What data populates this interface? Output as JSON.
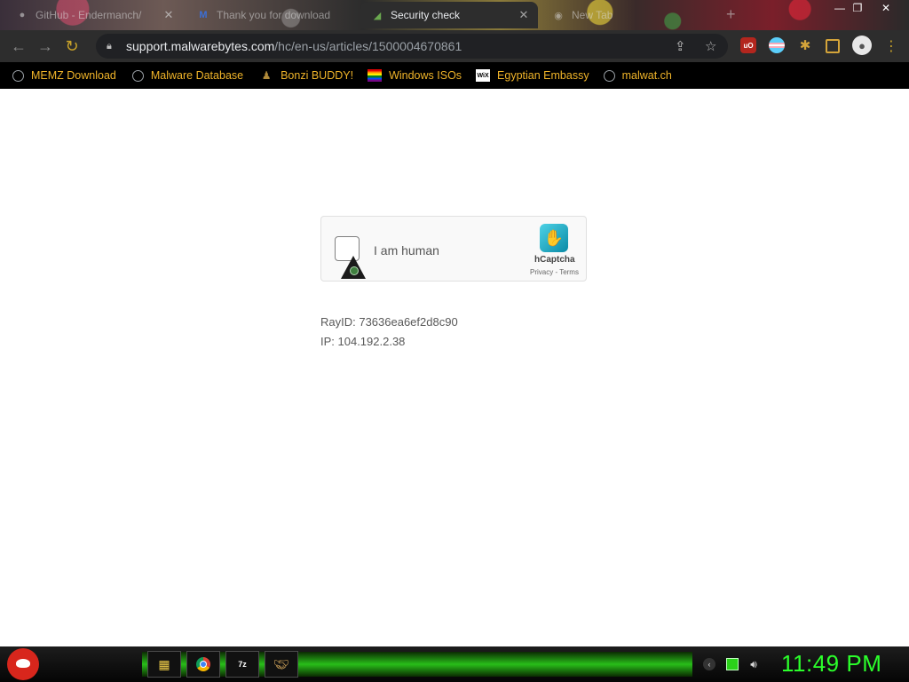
{
  "browser": {
    "tabs": [
      {
        "title": "GitHub - Endermanch/"
      },
      {
        "title": "Thank you for download"
      },
      {
        "title": "Security check"
      },
      {
        "title": "New Tab"
      }
    ],
    "url": {
      "host": "support.malwarebytes.com",
      "path": "/hc/en-us/articles/1500004670861"
    },
    "bookmarks": [
      {
        "label": "MEMZ Download",
        "icon": "globe-icon"
      },
      {
        "label": "Malware Database",
        "icon": "globe-icon"
      },
      {
        "label": "Bonzi BUDDY!",
        "icon": "bonzi-icon"
      },
      {
        "label": "Windows ISOs",
        "icon": "rainbow-flag-icon"
      },
      {
        "label": "Egyptian Embassy",
        "icon": "wix-icon"
      },
      {
        "label": "malwat.ch",
        "icon": "globe-icon"
      }
    ],
    "extensions": {
      "ublock_text": "uO"
    }
  },
  "captcha": {
    "label": "I am human",
    "brand": "hCaptcha",
    "links": "Privacy - Terms"
  },
  "info": {
    "ray": "RayID: 73636ea6ef2d8c90",
    "ip": "IP: 104.192.2.38"
  },
  "taskbar": {
    "clock": "11:49 PM",
    "seven_zip_text": "7z"
  },
  "colors": {
    "bookmark_text": "#f0b429",
    "clock": "#2bff2b",
    "toolbar": "#2d2d2d"
  }
}
